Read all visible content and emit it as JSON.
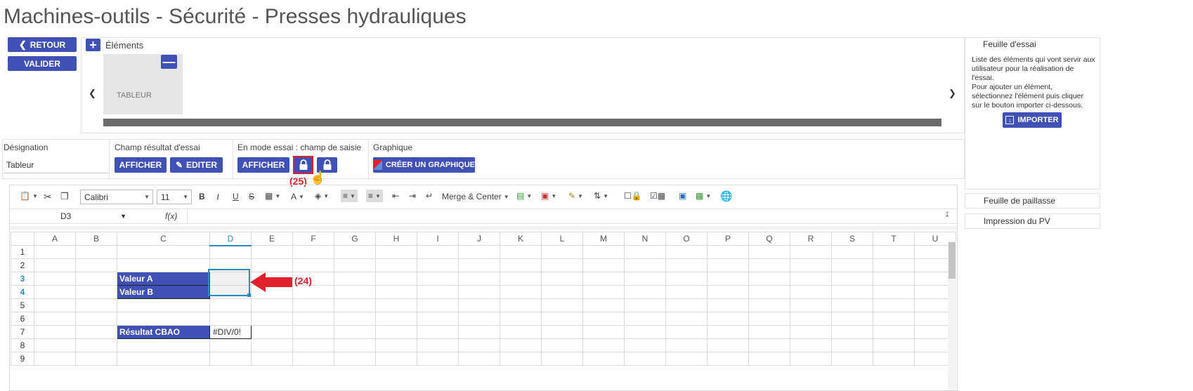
{
  "page": {
    "title": "Machines-outils - Sécurité - Presses hydrauliques"
  },
  "actions": {
    "back_label": "RETOUR",
    "validate_label": "VALIDER"
  },
  "elements": {
    "label": "Éléments",
    "items": [
      {
        "label": "TABLEUR"
      }
    ]
  },
  "right_panel": {
    "title": "Feuille d'essai",
    "description": "Liste des éléments qui vont servir aux utilisateur pour la réalisation de l'essai.\nPour ajouter un élément, sélectionnez l'élément puis cliquer sur le bouton importer ci-dessous.",
    "import_label": "IMPORTER",
    "tabs": [
      {
        "label": "Feuille de paillasse"
      },
      {
        "label": "Impression du PV"
      }
    ]
  },
  "props": {
    "designation_label": "Désignation",
    "designation_value": "Tableur",
    "result_field_label": "Champ résultat d'essai",
    "result_show_label": "AFFICHER",
    "result_edit_label": "EDITER",
    "test_mode_label": "En mode essai : champ de saisie",
    "test_mode_show_label": "AFFICHER",
    "graph_label": "Graphique",
    "create_graph_label": "CRÉER UN GRAPHIQUE"
  },
  "annotations": {
    "lock_callout": "(25)",
    "cells_callout": "(24)"
  },
  "toolbar": {
    "font_family": "Calibri",
    "font_size": "11",
    "merge_label": "Merge & Center"
  },
  "formula_bar": {
    "cell_ref": "D3",
    "fx_label": "f(x)",
    "formula": ""
  },
  "sheet": {
    "columns": [
      "A",
      "B",
      "C",
      "D",
      "E",
      "F",
      "G",
      "H",
      "I",
      "J",
      "K",
      "L",
      "M",
      "N",
      "O",
      "P",
      "Q",
      "R",
      "S",
      "T",
      "U"
    ],
    "selected_column": "D",
    "rows": [
      "1",
      "2",
      "3",
      "4",
      "5",
      "6",
      "7",
      "8",
      "9"
    ],
    "selected_rows": [
      "3",
      "4"
    ],
    "cells": {
      "C3": "Valeur A",
      "C4": "Valeur B",
      "C7": "Résultat CBAO",
      "D7": "#DIV/0!"
    }
  },
  "colors": {
    "primary": "#3f51b5",
    "highlight_red": "#e0202a",
    "selection_blue": "#2b8abf"
  }
}
